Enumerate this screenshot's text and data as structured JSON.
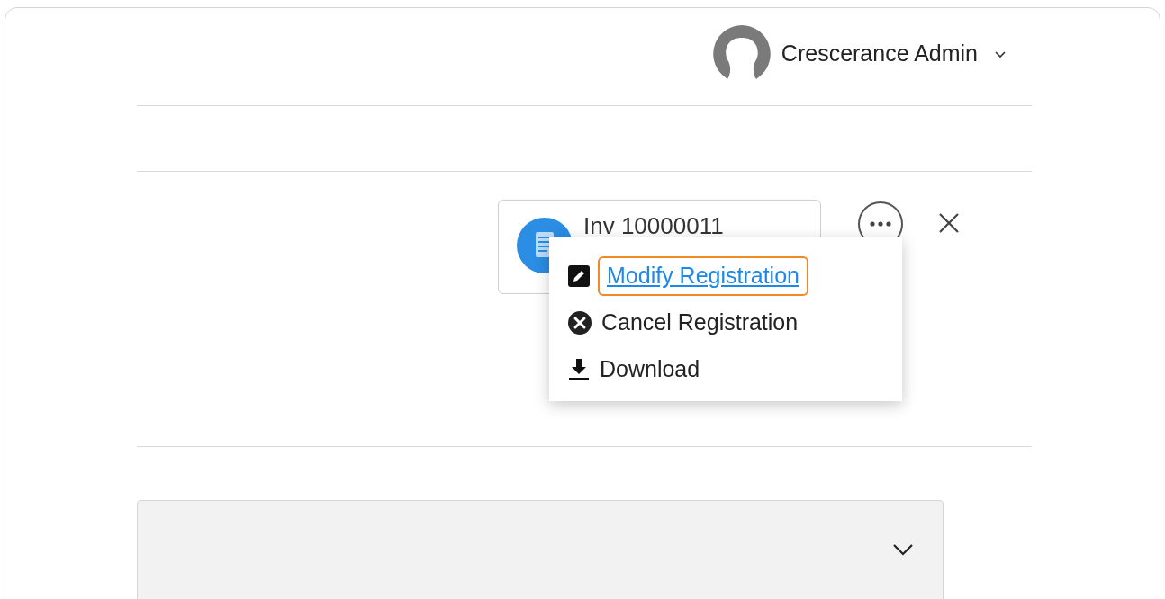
{
  "user_menu": {
    "name": "Crescerance Admin"
  },
  "invoice": {
    "title": "Inv 10000011"
  },
  "actions_menu": {
    "items": [
      {
        "label": "Modify Registration",
        "kind": "edit",
        "focused": true
      },
      {
        "label": "Cancel Registration",
        "kind": "cancel",
        "focused": false
      },
      {
        "label": "Download",
        "kind": "download",
        "focused": false
      }
    ]
  },
  "panel": {
    "expanded": false
  }
}
